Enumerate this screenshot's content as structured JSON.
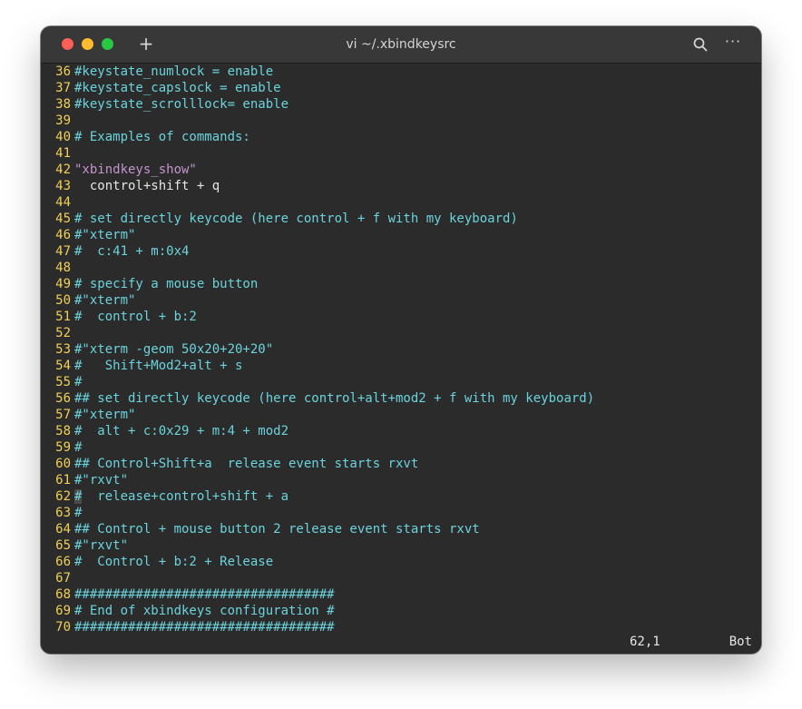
{
  "window": {
    "title": "vi ~/.xbindkeysrc",
    "new_tab_label": "+",
    "more_label": "···"
  },
  "editor": {
    "lines": [
      {
        "num": "36",
        "text": "#keystate_numlock = enable",
        "kind": "comment"
      },
      {
        "num": "37",
        "text": "#keystate_capslock = enable",
        "kind": "comment"
      },
      {
        "num": "38",
        "text": "#keystate_scrolllock= enable",
        "kind": "comment"
      },
      {
        "num": "39",
        "text": "",
        "kind": "comment"
      },
      {
        "num": "40",
        "text": "# Examples of commands:",
        "kind": "comment"
      },
      {
        "num": "41",
        "text": "",
        "kind": "comment"
      },
      {
        "num": "42",
        "text": "\"xbindkeys_show\"",
        "kind": "string"
      },
      {
        "num": "43",
        "text": "  control+shift + q",
        "kind": "plain"
      },
      {
        "num": "44",
        "text": "",
        "kind": "comment"
      },
      {
        "num": "45",
        "text": "# set directly keycode (here control + f with my keyboard)",
        "kind": "comment"
      },
      {
        "num": "46",
        "text": "#\"xterm\"",
        "kind": "comment"
      },
      {
        "num": "47",
        "text": "#  c:41 + m:0x4",
        "kind": "comment"
      },
      {
        "num": "48",
        "text": "",
        "kind": "comment"
      },
      {
        "num": "49",
        "text": "# specify a mouse button",
        "kind": "comment"
      },
      {
        "num": "50",
        "text": "#\"xterm\"",
        "kind": "comment"
      },
      {
        "num": "51",
        "text": "#  control + b:2",
        "kind": "comment"
      },
      {
        "num": "52",
        "text": "",
        "kind": "comment"
      },
      {
        "num": "53",
        "text": "#\"xterm -geom 50x20+20+20\"",
        "kind": "comment"
      },
      {
        "num": "54",
        "text": "#   Shift+Mod2+alt + s",
        "kind": "comment"
      },
      {
        "num": "55",
        "text": "#",
        "kind": "comment"
      },
      {
        "num": "56",
        "text": "## set directly keycode (here control+alt+mod2 + f with my keyboard)",
        "kind": "comment"
      },
      {
        "num": "57",
        "text": "#\"xterm\"",
        "kind": "comment"
      },
      {
        "num": "58",
        "text": "#  alt + c:0x29 + m:4 + mod2",
        "kind": "comment"
      },
      {
        "num": "59",
        "text": "#",
        "kind": "comment"
      },
      {
        "num": "60",
        "text": "## Control+Shift+a  release event starts rxvt",
        "kind": "comment"
      },
      {
        "num": "61",
        "text": "#\"rxvt\"",
        "kind": "comment"
      },
      {
        "num": "62",
        "text": "#  release+control+shift + a",
        "kind": "comment",
        "cursor": true
      },
      {
        "num": "63",
        "text": "#",
        "kind": "comment"
      },
      {
        "num": "64",
        "text": "## Control + mouse button 2 release event starts rxvt",
        "kind": "comment"
      },
      {
        "num": "65",
        "text": "#\"rxvt\"",
        "kind": "comment"
      },
      {
        "num": "66",
        "text": "#  Control + b:2 + Release",
        "kind": "comment"
      },
      {
        "num": "67",
        "text": "",
        "kind": "comment"
      },
      {
        "num": "68",
        "text": "##################################",
        "kind": "comment"
      },
      {
        "num": "69",
        "text": "# End of xbindkeys configuration #",
        "kind": "comment"
      },
      {
        "num": "70",
        "text": "##################################",
        "kind": "comment"
      }
    ]
  },
  "status": {
    "position": "62,1",
    "scroll": "Bot"
  },
  "colors": {
    "line_number": "#f2cf56",
    "comment": "#6bd3dc",
    "string": "#c593cf",
    "plain": "#e6e6e6",
    "background": "#2b2b2b"
  }
}
